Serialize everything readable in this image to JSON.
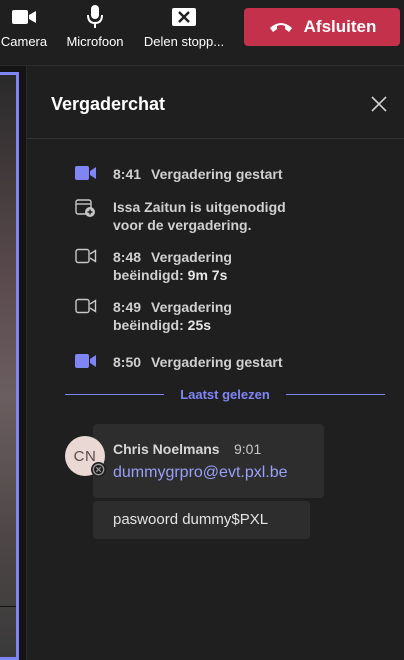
{
  "toolbar": {
    "camera": {
      "label": "Camera",
      "icon": "camera-icon"
    },
    "microphone": {
      "label": "Microfoon",
      "icon": "microphone-icon"
    },
    "share": {
      "label": "Delen stopp...",
      "icon": "stop-sharing-icon"
    },
    "leave": {
      "label": "Afsluiten",
      "icon": "hang-up-icon",
      "color": "#c4314b"
    }
  },
  "chat": {
    "title": "Vergaderchat",
    "events": [
      {
        "icon": "meeting-video-icon",
        "time": "8:41",
        "text": "Vergadering gestart"
      },
      {
        "icon": "invite-icon",
        "line1": "Issa Zaitun is uitgenodigd",
        "line2": "voor de vergadering."
      },
      {
        "icon": "meeting-ended-icon",
        "time": "8:48",
        "text": "Vergadering",
        "line2_prefix": "beëindigd:",
        "duration": "9m 7s"
      },
      {
        "icon": "meeting-ended-icon",
        "time": "8:49",
        "text": "Vergadering",
        "line2_prefix": "beëindigd:",
        "duration": "25s"
      },
      {
        "icon": "meeting-video-icon",
        "time": "8:50",
        "text": "Vergadering gestart"
      }
    ],
    "last_read": "Laatst gelezen",
    "message": {
      "initials": "CN",
      "sender": "Chris Noelmans",
      "time": "9:01",
      "link": "dummygrpro@evt.pxl.be",
      "followup": "paswoord dummy$PXL"
    }
  },
  "colors": {
    "accent": "#7f85f5",
    "leave": "#c4314b",
    "background": "#1f1f1f"
  }
}
